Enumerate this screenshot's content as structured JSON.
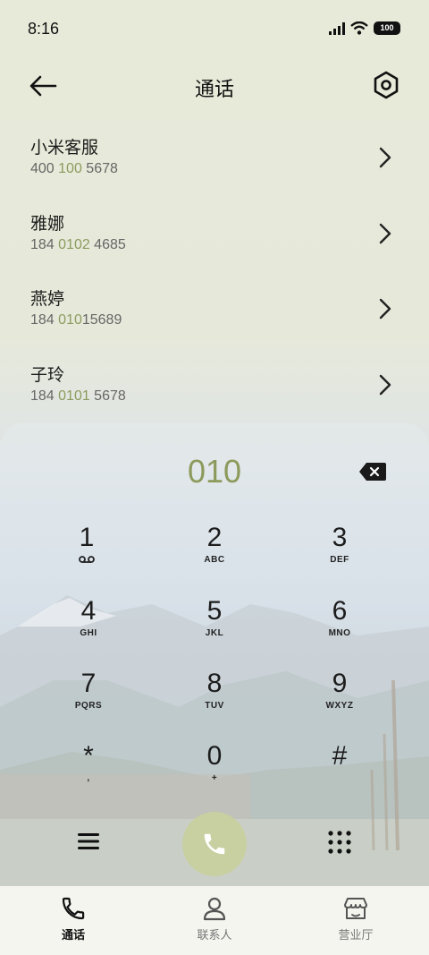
{
  "status_bar": {
    "time": "8:16",
    "battery": "100"
  },
  "header": {
    "title": "通话"
  },
  "contacts": [
    {
      "name": "小米客服",
      "number_pre": "400 ",
      "number_match": "100",
      "number_post": " 5678"
    },
    {
      "name": "雅娜",
      "number_pre": "184 ",
      "number_match": "0102",
      "number_post": " 4685"
    },
    {
      "name": "燕婷",
      "number_pre": "184 ",
      "number_match": "010",
      "number_post": "15689"
    },
    {
      "name": "子玲",
      "number_pre": "184 ",
      "number_match": "0101",
      "number_post": " 5678"
    }
  ],
  "dialpad": {
    "input": "010",
    "keys": [
      {
        "digit": "1",
        "letters": ""
      },
      {
        "digit": "2",
        "letters": "ABC"
      },
      {
        "digit": "3",
        "letters": "DEF"
      },
      {
        "digit": "4",
        "letters": "GHI"
      },
      {
        "digit": "5",
        "letters": "JKL"
      },
      {
        "digit": "6",
        "letters": "MNO"
      },
      {
        "digit": "7",
        "letters": "PQRS"
      },
      {
        "digit": "8",
        "letters": "TUV"
      },
      {
        "digit": "9",
        "letters": "WXYZ"
      },
      {
        "digit": "*",
        "letters": ","
      },
      {
        "digit": "0",
        "letters": "+"
      },
      {
        "digit": "#",
        "letters": ""
      }
    ]
  },
  "bottom_nav": {
    "items": [
      {
        "label": "通话",
        "icon": "phone-icon",
        "active": true
      },
      {
        "label": "联系人",
        "icon": "person-icon",
        "active": false
      },
      {
        "label": "营业厅",
        "icon": "store-icon",
        "active": false
      }
    ]
  },
  "colors": {
    "accent": "#8c9a5c",
    "call_button": "#c8cfa1"
  }
}
